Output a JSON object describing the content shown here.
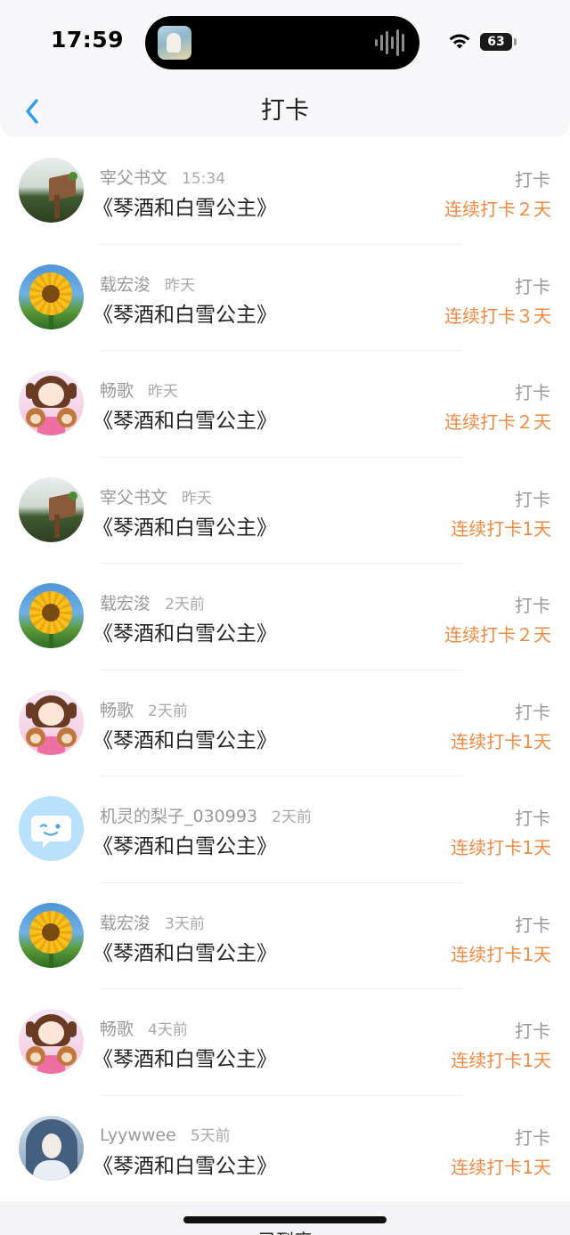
{
  "status_bar": {
    "time": "17:59",
    "battery": "63",
    "battery_level": 0.63
  },
  "nav": {
    "title": "打卡"
  },
  "colors": {
    "accent_blue": "#2f9bea",
    "streak_orange": "#ef8a43"
  },
  "checkins": [
    {
      "user": "宰父书文",
      "time": "15:34",
      "book": "《琴酒和白雪公主》",
      "action": "打卡",
      "streak": "连续打卡２天",
      "avatar": "bench-avatar"
    },
    {
      "user": "载宏浚",
      "time": "昨天",
      "book": "《琴酒和白雪公主》",
      "action": "打卡",
      "streak": "连续打卡３天",
      "avatar": "sunflower-avatar"
    },
    {
      "user": "畅歌",
      "time": "昨天",
      "book": "《琴酒和白雪公主》",
      "action": "打卡",
      "streak": "连续打卡２天",
      "avatar": "girl-avatar"
    },
    {
      "user": "宰父书文",
      "time": "昨天",
      "book": "《琴酒和白雪公主》",
      "action": "打卡",
      "streak": "连续打卡1天",
      "avatar": "bench-avatar"
    },
    {
      "user": "载宏浚",
      "time": "2天前",
      "book": "《琴酒和白雪公主》",
      "action": "打卡",
      "streak": "连续打卡２天",
      "avatar": "sunflower-avatar"
    },
    {
      "user": "畅歌",
      "time": "2天前",
      "book": "《琴酒和白雪公主》",
      "action": "打卡",
      "streak": "连续打卡1天",
      "avatar": "girl-avatar"
    },
    {
      "user": "机灵的梨子_030993",
      "time": "2天前",
      "book": "《琴酒和白雪公主》",
      "action": "打卡",
      "streak": "连续打卡1天",
      "avatar": "chat-bubble-avatar"
    },
    {
      "user": "载宏浚",
      "time": "3天前",
      "book": "《琴酒和白雪公主》",
      "action": "打卡",
      "streak": "连续打卡1天",
      "avatar": "sunflower-avatar"
    },
    {
      "user": "畅歌",
      "time": "4天前",
      "book": "《琴酒和白雪公主》",
      "action": "打卡",
      "streak": "连续打卡1天",
      "avatar": "girl-avatar"
    },
    {
      "user": "Lyywwee",
      "time": "5天前",
      "book": "《琴酒和白雪公主》",
      "action": "打卡",
      "streak": "连续打卡1天",
      "avatar": "anime-avatar"
    }
  ],
  "bottom": {
    "label": "已到底"
  }
}
